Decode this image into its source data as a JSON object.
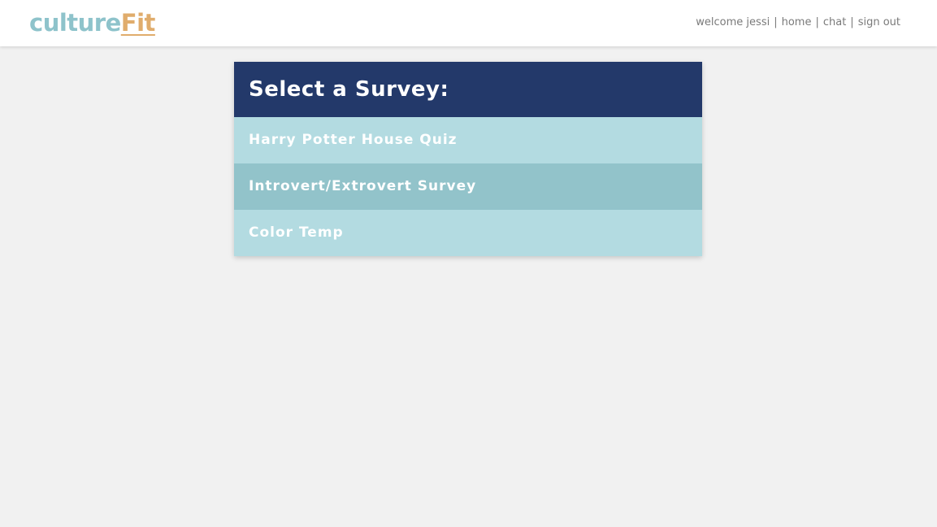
{
  "header": {
    "logo_part1": "culture",
    "logo_part2": "Fit",
    "nav": {
      "welcome": "welcome jessi",
      "home": "home",
      "chat": "chat",
      "sign_out": "sign out",
      "separator": "|"
    }
  },
  "colors": {
    "logo_primary": "#8ec3cb",
    "logo_accent": "#e0ac6c",
    "panel_header_bg": "#23396a",
    "item_bg": "#b3dbe1",
    "item_hover_bg": "#92c3ca",
    "page_bg": "#f1f1f1"
  },
  "survey_panel": {
    "title": "Select a Survey:",
    "items": [
      {
        "label": "Harry Potter House Quiz",
        "highlighted": false
      },
      {
        "label": "Introvert/Extrovert Survey",
        "highlighted": true
      },
      {
        "label": "Color Temp",
        "highlighted": false
      }
    ]
  }
}
